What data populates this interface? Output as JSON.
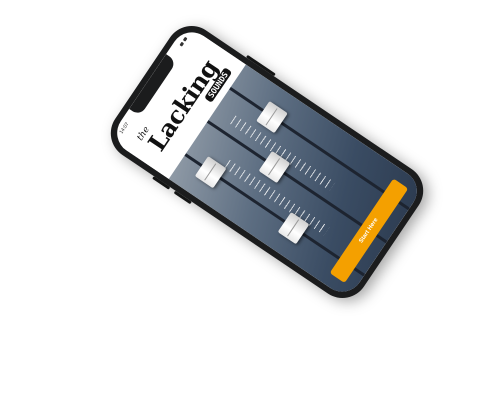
{
  "status_bar": {
    "time": "14:07"
  },
  "logo": {
    "the": "the",
    "main": "Lacking",
    "sub": "SOUNDS",
    "icon": "brand-logo"
  },
  "hero": {
    "image": "mixing-console-faders"
  },
  "cta": {
    "label": "Start Here"
  },
  "colors": {
    "accent": "#f4a000",
    "phone_frame": "#1b1c1d",
    "background": "#ffffff"
  }
}
